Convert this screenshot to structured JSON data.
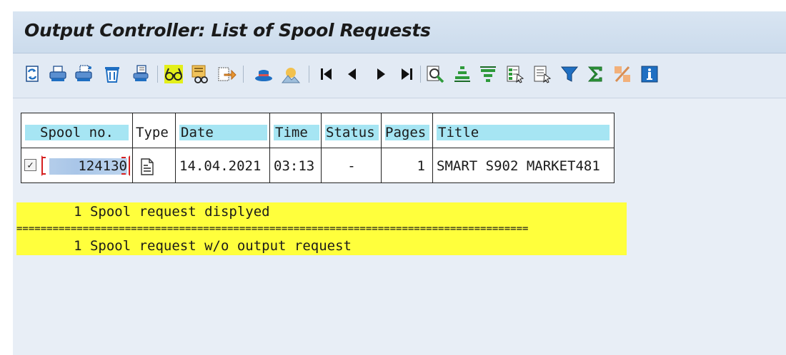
{
  "window": {
    "title": "Output Controller: List of Spool Requests"
  },
  "toolbar": {
    "buttons": [
      {
        "name": "refresh-icon"
      },
      {
        "name": "print-directly-icon"
      },
      {
        "name": "print-with-changed-parameters-icon"
      },
      {
        "name": "delete-icon"
      },
      {
        "name": "print-attributes-icon"
      },
      {
        "name": "display-contents-icon"
      },
      {
        "name": "display-details-icon"
      },
      {
        "name": "forward-icon"
      },
      {
        "name": "output-request-icon"
      },
      {
        "name": "graphical-display-icon"
      },
      {
        "name": "first-page-icon"
      },
      {
        "name": "previous-page-icon"
      },
      {
        "name": "next-page-icon"
      },
      {
        "name": "last-page-icon"
      },
      {
        "name": "find-icon"
      },
      {
        "name": "sort-ascending-icon"
      },
      {
        "name": "sort-descending-icon"
      },
      {
        "name": "select-layout-icon"
      },
      {
        "name": "change-layout-icon"
      },
      {
        "name": "filter-icon"
      },
      {
        "name": "total-icon"
      },
      {
        "name": "subtotal-icon"
      },
      {
        "name": "information-icon"
      }
    ],
    "colors": {
      "blue": "#1f6fc2",
      "green": "#2e9a3b",
      "highlight": "#e3ef1a",
      "orange": "#e8952f"
    }
  },
  "table": {
    "headers": {
      "spool_no": "Spool no.",
      "type": "Type",
      "date": "Date",
      "time": "Time",
      "status": "Status",
      "pages": "Pages",
      "title": "Title"
    },
    "rows": [
      {
        "checked": true,
        "spool_no": "124130",
        "type_icon": "document-icon",
        "date": "14.04.2021",
        "time": "03:13",
        "status": "-",
        "pages": "1",
        "title": "SMART S902 MARKET481"
      }
    ]
  },
  "summary": {
    "line1": "       1 Spool request displyed",
    "separator": "=====================================================================================",
    "line2": "       1 Spool request w/o output request"
  },
  "colors": {
    "header_cell": "#a6e5f3",
    "summary_bg": "#ffff3c",
    "focus_border": "#d62020"
  }
}
